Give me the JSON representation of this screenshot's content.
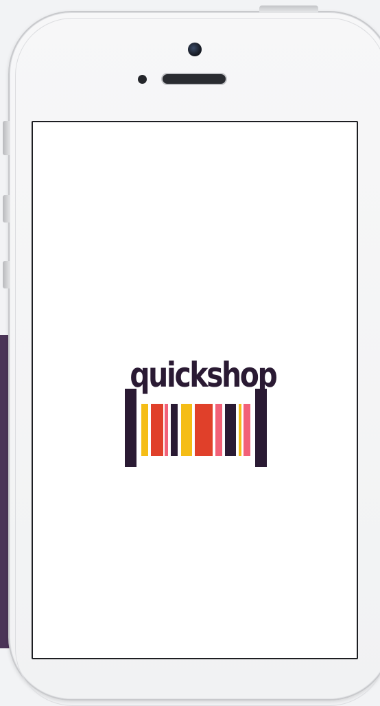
{
  "app": {
    "logo_text": "quickshop",
    "logo_icon": "barcode-logo-icon"
  },
  "colors": {
    "dark": "#2a1a33",
    "yellow": "#f5bd16",
    "red": "#e0402a",
    "pink": "#f26178",
    "purple_panel": "#4a3457"
  }
}
